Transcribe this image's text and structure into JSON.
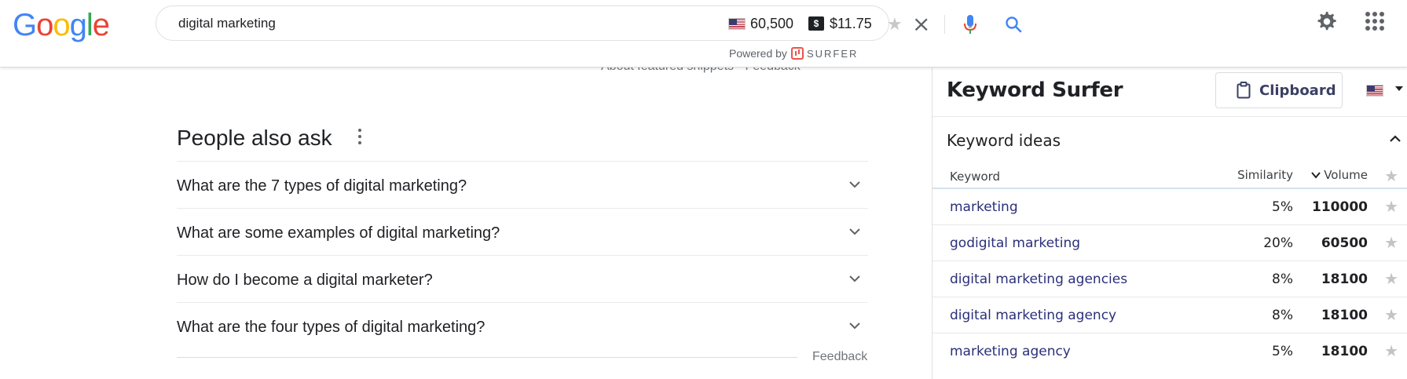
{
  "header": {
    "logo": {
      "letters": [
        "G",
        "o",
        "o",
        "g",
        "l",
        "e"
      ],
      "colors": [
        "#4285F4",
        "#EA4335",
        "#FBBC05",
        "#4285F4",
        "#34A853",
        "#EA4335"
      ]
    },
    "search": {
      "query": "digital marketing",
      "volume": "60,500",
      "dollar_icon": "$",
      "cpc": "$11.75",
      "icons": [
        "us-flag-icon",
        "star-icon",
        "clear-icon",
        "mic-icon",
        "search-icon"
      ]
    },
    "powered_by": {
      "label": "Powered by",
      "brand": "SURFER"
    },
    "right_icons": [
      "gear-icon",
      "apps-grid-icon"
    ]
  },
  "main": {
    "featured_snippet_footer": "About featured snippets  •  Feedback",
    "people_also_ask": {
      "title": "People also ask",
      "questions": [
        "What are the 7 types of digital marketing?",
        "What are some examples of digital marketing?",
        "How do I become a digital marketer?",
        "What are the four types of digital marketing?"
      ],
      "feedback": "Feedback"
    }
  },
  "keyword_surfer": {
    "title": "Keyword Surfer",
    "clipboard_label": "Clipboard",
    "section_title": "Keyword ideas",
    "columns": {
      "keyword": "Keyword",
      "similarity": "Similarity",
      "volume": "Volume"
    },
    "rows": [
      {
        "keyword": "marketing",
        "similarity": "5%",
        "volume": "110000"
      },
      {
        "keyword": "godigital marketing",
        "similarity": "20%",
        "volume": "60500"
      },
      {
        "keyword": "digital marketing agencies",
        "similarity": "8%",
        "volume": "18100"
      },
      {
        "keyword": "digital marketing agency",
        "similarity": "8%",
        "volume": "18100"
      },
      {
        "keyword": "marketing agency",
        "similarity": "5%",
        "volume": "18100"
      }
    ]
  },
  "colors": {
    "accent_blue": "#1a73e8",
    "keyword_link": "#2a2f7a",
    "surfer_red": "#e8554e",
    "star_inactive": "#c4c4c4"
  }
}
